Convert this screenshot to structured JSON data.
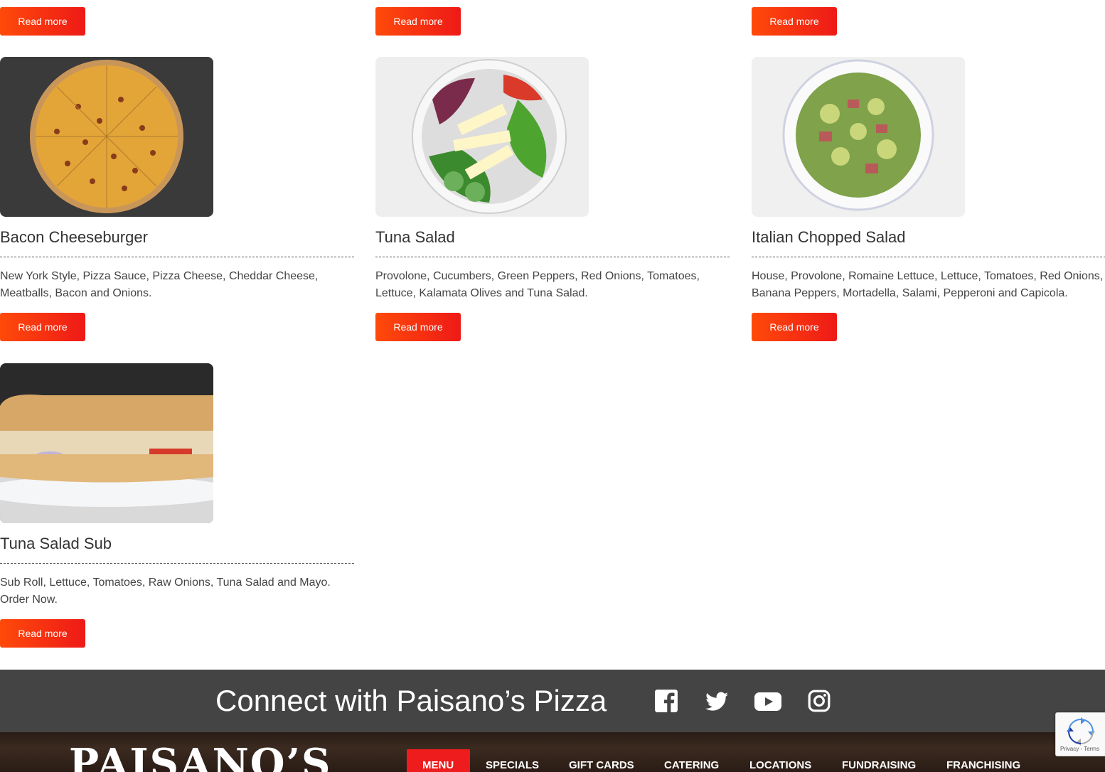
{
  "top_buttons": [
    "Read more",
    "Read more",
    "Read more"
  ],
  "cards": [
    {
      "title": "Bacon Cheeseburger",
      "desc": "New York Style, Pizza Sauce, Pizza Cheese, Cheddar Cheese, Meatballs, Bacon and Onions.",
      "button": "Read more",
      "image": "pizza-image"
    },
    {
      "title": "Tuna Salad",
      "desc": "Provolone, Cucumbers, Green Peppers, Red Onions, Tomatoes, Lettuce, Kalamata Olives and Tuna Salad.",
      "button": "Read more",
      "image": "tuna-salad-image"
    },
    {
      "title": "Italian Chopped Salad",
      "desc": "House, Provolone, Romaine Lettuce, Lettuce, Tomatoes, Red Onions, Banana Peppers, Mortadella, Salami, Pepperoni and Capicola.",
      "button": "Read more",
      "image": "chopped-salad-image"
    },
    {
      "title": "Tuna Salad Sub",
      "desc": "Sub Roll, Lettuce, Tomatoes, Raw Onions, Tuna Salad and Mayo. Order Now.",
      "button": "Read more",
      "image": "tuna-sub-image"
    }
  ],
  "connect": {
    "text": "Connect with Paisano’s Pizza",
    "icons": [
      "facebook-icon",
      "twitter-icon",
      "youtube-icon",
      "instagram-icon"
    ]
  },
  "footer": {
    "logo": "PAISANO’S",
    "nav": [
      "MENU",
      "SPECIALS",
      "GIFT CARDS",
      "CATERING",
      "LOCATIONS",
      "FUNDRAISING",
      "FRANCHISING"
    ],
    "active": "MENU"
  },
  "recaptcha": {
    "links": "Privacy - Terms"
  },
  "colors": {
    "button_start": "#ff4a0a",
    "button_end": "#ee1a17",
    "connect_bg": "#444444",
    "nav_active": "#ee1c1c"
  }
}
